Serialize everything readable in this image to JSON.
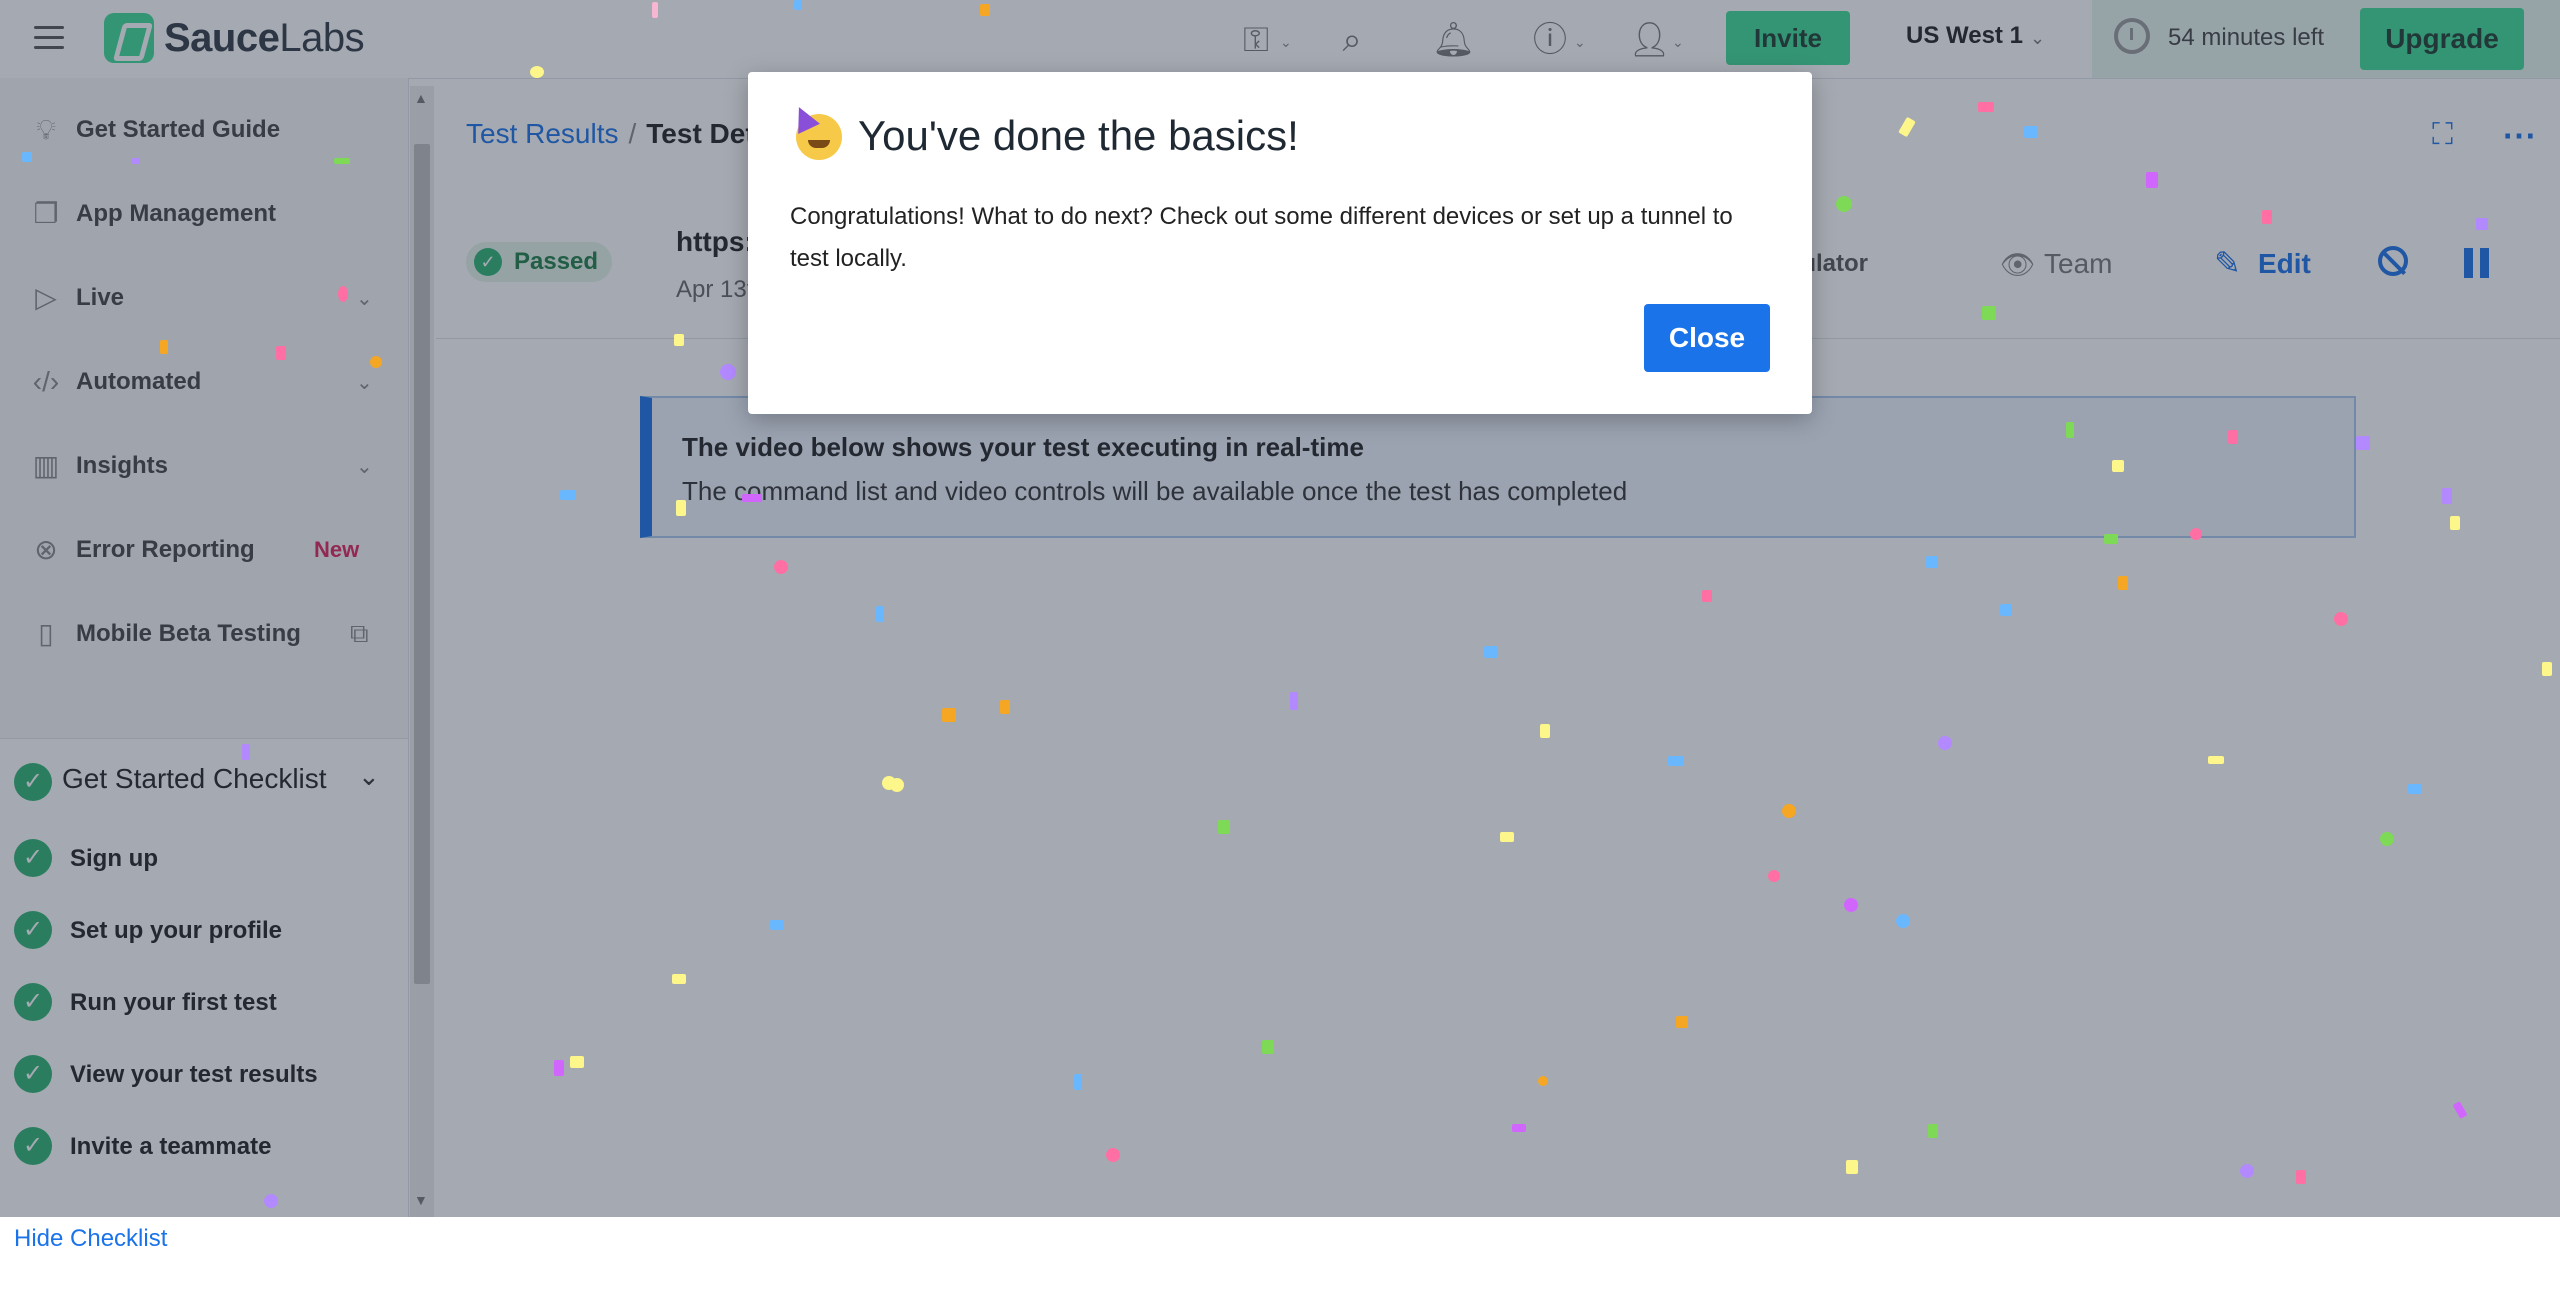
{
  "header": {
    "logo_text_bold": "Sauce",
    "logo_text_light": "Labs",
    "invite_label": "Invite",
    "region": "US West 1",
    "time_left": "54 minutes left",
    "upgrade_label": "Upgrade"
  },
  "sidebar": {
    "items": [
      {
        "label": "Get Started Guide",
        "icon": "lightbulb-icon"
      },
      {
        "label": "App Management",
        "icon": "apps-icon"
      },
      {
        "label": "Live",
        "icon": "play-icon"
      },
      {
        "label": "Automated",
        "icon": "code-icon"
      },
      {
        "label": "Insights",
        "icon": "bar-chart-icon"
      },
      {
        "label": "Error Reporting",
        "icon": "bug-icon",
        "badge": "New"
      },
      {
        "label": "Mobile Beta Testing",
        "icon": "phone-icon"
      }
    ],
    "checklist": {
      "title": "Get Started Checklist",
      "items": [
        "Sign up",
        "Set up your profile",
        "Run your first test",
        "View your test results",
        "Invite a teammate"
      ],
      "hide_label": "Hide Checklist"
    }
  },
  "main": {
    "breadcrumb": {
      "link": "Test Results",
      "separator": "/",
      "current": "Test Deta"
    },
    "test": {
      "status": "Passed",
      "url": "https:",
      "date": "Apr 13t",
      "platform": "mulator",
      "visibility": "Team",
      "edit_label": "Edit"
    },
    "info": {
      "title": "The video below shows your test executing in real-time",
      "subtitle": "The command list and video controls will be available once the test has completed"
    }
  },
  "modal": {
    "title": "You've done the basics!",
    "text": "Congratulations! What to do next? Check out some different devices or set up a tunnel to test locally.",
    "close_label": "Close"
  },
  "colors": {
    "brand_green": "#3ddc97",
    "link_blue": "#1a73e8",
    "success_green": "#2bb673",
    "badge_red": "#e0245e"
  }
}
